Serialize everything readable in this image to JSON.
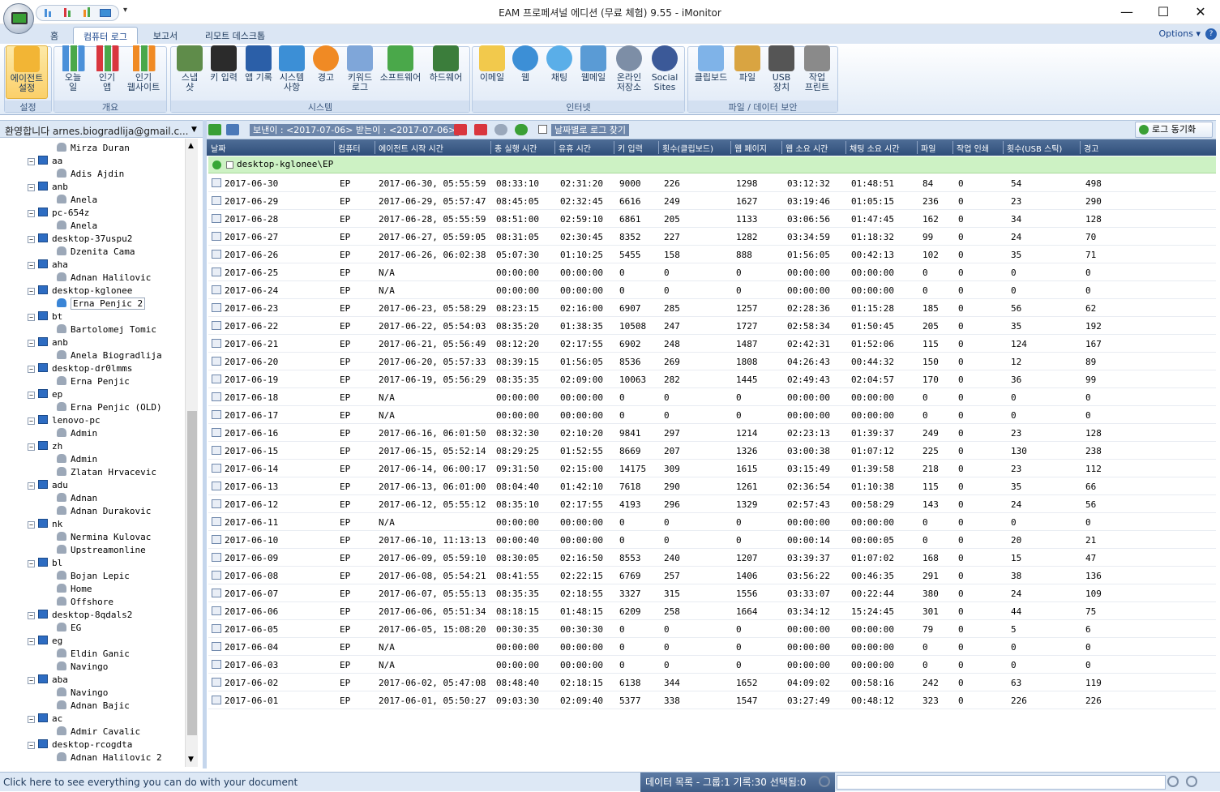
{
  "window": {
    "title": "EAM 프로페셔널 에디션 (무료 체험) 9.55 - iMonitor"
  },
  "tabs": [
    {
      "label": "홈"
    },
    {
      "label": "컴퓨터 로그"
    },
    {
      "label": "보고서"
    },
    {
      "label": "리모트 데스크톱"
    }
  ],
  "options_label": "Options",
  "ribbon": {
    "groups": [
      {
        "label": "설정"
      },
      {
        "label": "개요"
      },
      {
        "label": "시스템"
      },
      {
        "label": "인터넷"
      },
      {
        "label": "파일 / 데이터 보안"
      }
    ],
    "buttons": [
      {
        "label": "에이전트\n설정",
        "icon": "agent-settings-icon",
        "color": "#f2b535"
      },
      {
        "label": "오늘\n일",
        "icon": "bar-chart-icon",
        "color": "#4a90d9"
      },
      {
        "label": "인기\n앱",
        "icon": "bar-chart-icon",
        "color": "#d9363e"
      },
      {
        "label": "인기\n웹사이트",
        "icon": "bar-chart-icon",
        "color": "#f08a24"
      },
      {
        "label": "스냅\n샷",
        "icon": "snapshot-icon",
        "color": "#5f8c4a"
      },
      {
        "label": "키 입력",
        "icon": "keyboard-icon",
        "color": "#2b2b2b"
      },
      {
        "label": "앱 기록",
        "icon": "window-icon",
        "color": "#2b5fa8"
      },
      {
        "label": "시스템\n사항",
        "icon": "windows-icon",
        "color": "#3c8fd6"
      },
      {
        "label": "경고",
        "icon": "warning-icon",
        "color": "#f08a24"
      },
      {
        "label": "키워드\n로그",
        "icon": "keyword-log-icon",
        "color": "#7fa6d9"
      },
      {
        "label": "소프트웨어",
        "icon": "software-icon",
        "color": "#4aa84a"
      },
      {
        "label": "하드웨어",
        "icon": "hardware-icon",
        "color": "#3b7d3b"
      },
      {
        "label": "이메일",
        "icon": "email-icon",
        "color": "#f2c94c"
      },
      {
        "label": "웹",
        "icon": "globe-icon",
        "color": "#3c8fd6"
      },
      {
        "label": "채팅",
        "icon": "chat-icon",
        "color": "#5aaee8"
      },
      {
        "label": "웹메일",
        "icon": "webmail-icon",
        "color": "#5a9bd5"
      },
      {
        "label": "온라인\n저장소",
        "icon": "online-storage-icon",
        "color": "#7d8ea6"
      },
      {
        "label": "Social\nSites",
        "icon": "facebook-icon",
        "color": "#3b5998"
      },
      {
        "label": "클립보드",
        "icon": "clipboard-icon",
        "color": "#7fb3e8"
      },
      {
        "label": "파일",
        "icon": "file-icon",
        "color": "#d9a441"
      },
      {
        "label": "USB\n장치",
        "icon": "usb-icon",
        "color": "#555555"
      },
      {
        "label": "작업\n프린트",
        "icon": "printer-icon",
        "color": "#8a8a8a"
      }
    ]
  },
  "welcome": {
    "text": "환영합니다 arnes.biogradlija@gmail.c..."
  },
  "tree": [
    {
      "label": "Mirza Duran",
      "type": "user"
    },
    {
      "label": "aa",
      "type": "computer"
    },
    {
      "label": "Adis Ajdin",
      "type": "user"
    },
    {
      "label": "anb",
      "type": "computer"
    },
    {
      "label": "Anela",
      "type": "user"
    },
    {
      "label": "pc-654z",
      "type": "computer"
    },
    {
      "label": "Anela",
      "type": "user"
    },
    {
      "label": "desktop-37uspu2",
      "type": "computer"
    },
    {
      "label": "Dzenita Cama",
      "type": "user"
    },
    {
      "label": "aha",
      "type": "computer"
    },
    {
      "label": "Adnan Halilovic",
      "type": "user"
    },
    {
      "label": "desktop-kglonee",
      "type": "computer"
    },
    {
      "label": "Erna Penjic 2",
      "type": "user",
      "selected": true
    },
    {
      "label": "bt",
      "type": "computer"
    },
    {
      "label": "Bartolomej Tomic",
      "type": "user"
    },
    {
      "label": "anb",
      "type": "computer"
    },
    {
      "label": "Anela Biogradlija",
      "type": "user"
    },
    {
      "label": "desktop-dr0lmms",
      "type": "computer"
    },
    {
      "label": "Erna Penjic",
      "type": "user"
    },
    {
      "label": "ep",
      "type": "computer"
    },
    {
      "label": "Erna Penjic (OLD)",
      "type": "user"
    },
    {
      "label": "lenovo-pc",
      "type": "computer"
    },
    {
      "label": "Admin",
      "type": "user"
    },
    {
      "label": "zh",
      "type": "computer"
    },
    {
      "label": "Admin",
      "type": "user"
    },
    {
      "label": "Zlatan Hrvacevic",
      "type": "user"
    },
    {
      "label": "adu",
      "type": "computer"
    },
    {
      "label": "Adnan",
      "type": "user"
    },
    {
      "label": "Adnan Durakovic",
      "type": "user"
    },
    {
      "label": "nk",
      "type": "computer"
    },
    {
      "label": "Nermina Kulovac",
      "type": "user"
    },
    {
      "label": "Upstreamonline",
      "type": "user"
    },
    {
      "label": "bl",
      "type": "computer"
    },
    {
      "label": "Bojan Lepic",
      "type": "user"
    },
    {
      "label": "Home",
      "type": "user"
    },
    {
      "label": "Offshore",
      "type": "user"
    },
    {
      "label": "desktop-8qdals2",
      "type": "computer"
    },
    {
      "label": "EG",
      "type": "user"
    },
    {
      "label": "eg",
      "type": "computer"
    },
    {
      "label": "Eldin Ganic",
      "type": "user"
    },
    {
      "label": "Navingo",
      "type": "user"
    },
    {
      "label": "aba",
      "type": "computer"
    },
    {
      "label": "Navingo",
      "type": "user"
    },
    {
      "label": "Adnan Bajic",
      "type": "user"
    },
    {
      "label": "ac",
      "type": "computer"
    },
    {
      "label": "Admir Cavalic",
      "type": "user"
    },
    {
      "label": "desktop-rcogdta",
      "type": "computer"
    },
    {
      "label": "Adnan Halilovic 2",
      "type": "user"
    }
  ],
  "toolbar2": {
    "range_text": "보낸이 : <2017-07-06> 받는이 : <2017-07-06>",
    "find_by_date": "날짜별로 로그 찾기",
    "sync_label": "로그 동기화"
  },
  "grid": {
    "columns": [
      "날짜",
      "컴퓨터",
      "에이전트 시작 시간",
      "총 실행 시간",
      "유휴 시간",
      "키 입력",
      "횟수(클립보드)",
      "웹 페이지",
      "웹 소요 시간",
      "채팅 소요 시간",
      "파일",
      "작업 인쇄",
      "횟수(USB 스틱)",
      "경고"
    ],
    "group_label": "desktop-kglonee\\EP",
    "rows": [
      [
        "2017-06-30",
        "EP",
        "2017-06-30, 05:55:59",
        "08:33:10",
        "02:31:20",
        "9000",
        "226",
        "1298",
        "03:12:32",
        "01:48:51",
        "84",
        "0",
        "54",
        "498"
      ],
      [
        "2017-06-29",
        "EP",
        "2017-06-29, 05:57:47",
        "08:45:05",
        "02:32:45",
        "6616",
        "249",
        "1627",
        "03:19:46",
        "01:05:15",
        "236",
        "0",
        "23",
        "290"
      ],
      [
        "2017-06-28",
        "EP",
        "2017-06-28, 05:55:59",
        "08:51:00",
        "02:59:10",
        "6861",
        "205",
        "1133",
        "03:06:56",
        "01:47:45",
        "162",
        "0",
        "34",
        "128"
      ],
      [
        "2017-06-27",
        "EP",
        "2017-06-27, 05:59:05",
        "08:31:05",
        "02:30:45",
        "8352",
        "227",
        "1282",
        "03:34:59",
        "01:18:32",
        "99",
        "0",
        "24",
        "70"
      ],
      [
        "2017-06-26",
        "EP",
        "2017-06-26, 06:02:38",
        "05:07:30",
        "01:10:25",
        "5455",
        "158",
        "888",
        "01:56:05",
        "00:42:13",
        "102",
        "0",
        "35",
        "71"
      ],
      [
        "2017-06-25",
        "EP",
        "N/A",
        "00:00:00",
        "00:00:00",
        "0",
        "0",
        "0",
        "00:00:00",
        "00:00:00",
        "0",
        "0",
        "0",
        "0"
      ],
      [
        "2017-06-24",
        "EP",
        "N/A",
        "00:00:00",
        "00:00:00",
        "0",
        "0",
        "0",
        "00:00:00",
        "00:00:00",
        "0",
        "0",
        "0",
        "0"
      ],
      [
        "2017-06-23",
        "EP",
        "2017-06-23, 05:58:29",
        "08:23:15",
        "02:16:00",
        "6907",
        "285",
        "1257",
        "02:28:36",
        "01:15:28",
        "185",
        "0",
        "56",
        "62"
      ],
      [
        "2017-06-22",
        "EP",
        "2017-06-22, 05:54:03",
        "08:35:20",
        "01:38:35",
        "10508",
        "247",
        "1727",
        "02:58:34",
        "01:50:45",
        "205",
        "0",
        "35",
        "192"
      ],
      [
        "2017-06-21",
        "EP",
        "2017-06-21, 05:56:49",
        "08:12:20",
        "02:17:55",
        "6902",
        "248",
        "1487",
        "02:42:31",
        "01:52:06",
        "115",
        "0",
        "124",
        "167"
      ],
      [
        "2017-06-20",
        "EP",
        "2017-06-20, 05:57:33",
        "08:39:15",
        "01:56:05",
        "8536",
        "269",
        "1808",
        "04:26:43",
        "00:44:32",
        "150",
        "0",
        "12",
        "89"
      ],
      [
        "2017-06-19",
        "EP",
        "2017-06-19, 05:56:29",
        "08:35:35",
        "02:09:00",
        "10063",
        "282",
        "1445",
        "02:49:43",
        "02:04:57",
        "170",
        "0",
        "36",
        "99"
      ],
      [
        "2017-06-18",
        "EP",
        "N/A",
        "00:00:00",
        "00:00:00",
        "0",
        "0",
        "0",
        "00:00:00",
        "00:00:00",
        "0",
        "0",
        "0",
        "0"
      ],
      [
        "2017-06-17",
        "EP",
        "N/A",
        "00:00:00",
        "00:00:00",
        "0",
        "0",
        "0",
        "00:00:00",
        "00:00:00",
        "0",
        "0",
        "0",
        "0"
      ],
      [
        "2017-06-16",
        "EP",
        "2017-06-16, 06:01:50",
        "08:32:30",
        "02:10:20",
        "9841",
        "297",
        "1214",
        "02:23:13",
        "01:39:37",
        "249",
        "0",
        "23",
        "128"
      ],
      [
        "2017-06-15",
        "EP",
        "2017-06-15, 05:52:14",
        "08:29:25",
        "01:52:55",
        "8669",
        "207",
        "1326",
        "03:00:38",
        "01:07:12",
        "225",
        "0",
        "130",
        "238"
      ],
      [
        "2017-06-14",
        "EP",
        "2017-06-14, 06:00:17",
        "09:31:50",
        "02:15:00",
        "14175",
        "309",
        "1615",
        "03:15:49",
        "01:39:58",
        "218",
        "0",
        "23",
        "112"
      ],
      [
        "2017-06-13",
        "EP",
        "2017-06-13, 06:01:00",
        "08:04:40",
        "01:42:10",
        "7618",
        "290",
        "1261",
        "02:36:54",
        "01:10:38",
        "115",
        "0",
        "35",
        "66"
      ],
      [
        "2017-06-12",
        "EP",
        "2017-06-12, 05:55:12",
        "08:35:10",
        "02:17:55",
        "4193",
        "296",
        "1329",
        "02:57:43",
        "00:58:29",
        "143",
        "0",
        "24",
        "56"
      ],
      [
        "2017-06-11",
        "EP",
        "N/A",
        "00:00:00",
        "00:00:00",
        "0",
        "0",
        "0",
        "00:00:00",
        "00:00:00",
        "0",
        "0",
        "0",
        "0"
      ],
      [
        "2017-06-10",
        "EP",
        "2017-06-10, 11:13:13",
        "00:00:40",
        "00:00:00",
        "0",
        "0",
        "0",
        "00:00:14",
        "00:00:05",
        "0",
        "0",
        "20",
        "21"
      ],
      [
        "2017-06-09",
        "EP",
        "2017-06-09, 05:59:10",
        "08:30:05",
        "02:16:50",
        "8553",
        "240",
        "1207",
        "03:39:37",
        "01:07:02",
        "168",
        "0",
        "15",
        "47"
      ],
      [
        "2017-06-08",
        "EP",
        "2017-06-08, 05:54:21",
        "08:41:55",
        "02:22:15",
        "6769",
        "257",
        "1406",
        "03:56:22",
        "00:46:35",
        "291",
        "0",
        "38",
        "136"
      ],
      [
        "2017-06-07",
        "EP",
        "2017-06-07, 05:55:13",
        "08:35:35",
        "02:18:55",
        "3327",
        "315",
        "1556",
        "03:33:07",
        "00:22:44",
        "380",
        "0",
        "24",
        "109"
      ],
      [
        "2017-06-06",
        "EP",
        "2017-06-06, 05:51:34",
        "08:18:15",
        "01:48:15",
        "6209",
        "258",
        "1664",
        "03:34:12",
        "15:24:45",
        "301",
        "0",
        "44",
        "75"
      ],
      [
        "2017-06-05",
        "EP",
        "2017-06-05, 15:08:20",
        "00:30:35",
        "00:30:30",
        "0",
        "0",
        "0",
        "00:00:00",
        "00:00:00",
        "79",
        "0",
        "5",
        "6"
      ],
      [
        "2017-06-04",
        "EP",
        "N/A",
        "00:00:00",
        "00:00:00",
        "0",
        "0",
        "0",
        "00:00:00",
        "00:00:00",
        "0",
        "0",
        "0",
        "0"
      ],
      [
        "2017-06-03",
        "EP",
        "N/A",
        "00:00:00",
        "00:00:00",
        "0",
        "0",
        "0",
        "00:00:00",
        "00:00:00",
        "0",
        "0",
        "0",
        "0"
      ],
      [
        "2017-06-02",
        "EP",
        "2017-06-02, 05:47:08",
        "08:48:40",
        "02:18:15",
        "6138",
        "344",
        "1652",
        "04:09:02",
        "00:58:16",
        "242",
        "0",
        "63",
        "119"
      ],
      [
        "2017-06-01",
        "EP",
        "2017-06-01, 05:50:27",
        "09:03:30",
        "02:09:40",
        "5377",
        "338",
        "1547",
        "03:27:49",
        "00:48:12",
        "323",
        "0",
        "226",
        "226"
      ]
    ]
  },
  "status": {
    "left": "Click here to see everything you can do with your document",
    "right": "데이터 목록 - 그룹:1 기록:30 선택됨:0"
  }
}
